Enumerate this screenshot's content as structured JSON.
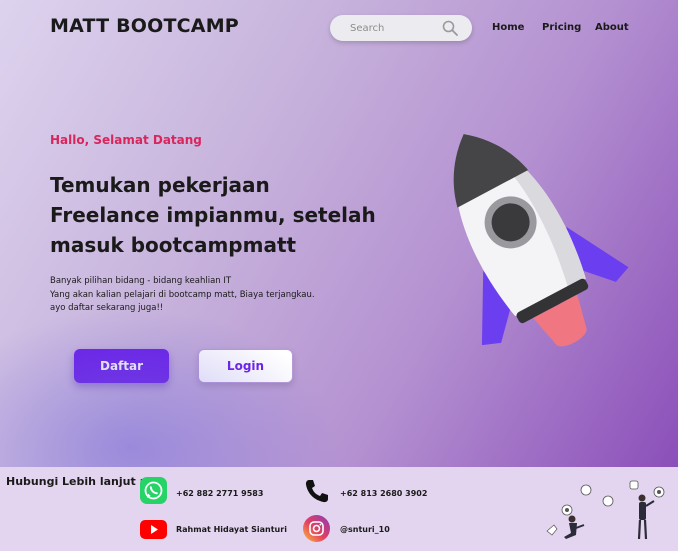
{
  "header": {
    "brand": "MATT BOOTCAMP",
    "search_placeholder": "Search",
    "nav": [
      "Home",
      "Pricing",
      "About"
    ]
  },
  "hero": {
    "greeting": "Hallo, Selamat Datang",
    "headline": [
      "Temukan pekerjaan",
      "Freelance impianmu, setelah",
      "masuk bootcampmatt"
    ],
    "description": [
      "Banyak pilihan bidang - bidang keahlian IT",
      "Yang akan kalian pelajari di bootcamp matt, Biaya terjangkau.",
      "ayo daftar sekarang juga!!"
    ],
    "buttons": {
      "register": "Daftar",
      "login": "Login"
    }
  },
  "footer": {
    "title": "Hubungi Lebih lanjut :",
    "contacts": {
      "whatsapp": "+62 882 2771 9583",
      "phone": "+62 813 2680 3902",
      "youtube": "Rahmat Hidayat Sianturi",
      "instagram": "@snturi_10"
    }
  },
  "colors": {
    "accent": "#6a1de8",
    "greeting": "#d8265d",
    "whatsapp": "#25d366",
    "youtube": "#ff0000",
    "footer_bg": "#e3d5ef"
  },
  "icons": [
    "search-icon",
    "whatsapp-icon",
    "phone-icon",
    "youtube-icon",
    "instagram-icon",
    "rocket-illustration",
    "social-people-illustration"
  ]
}
